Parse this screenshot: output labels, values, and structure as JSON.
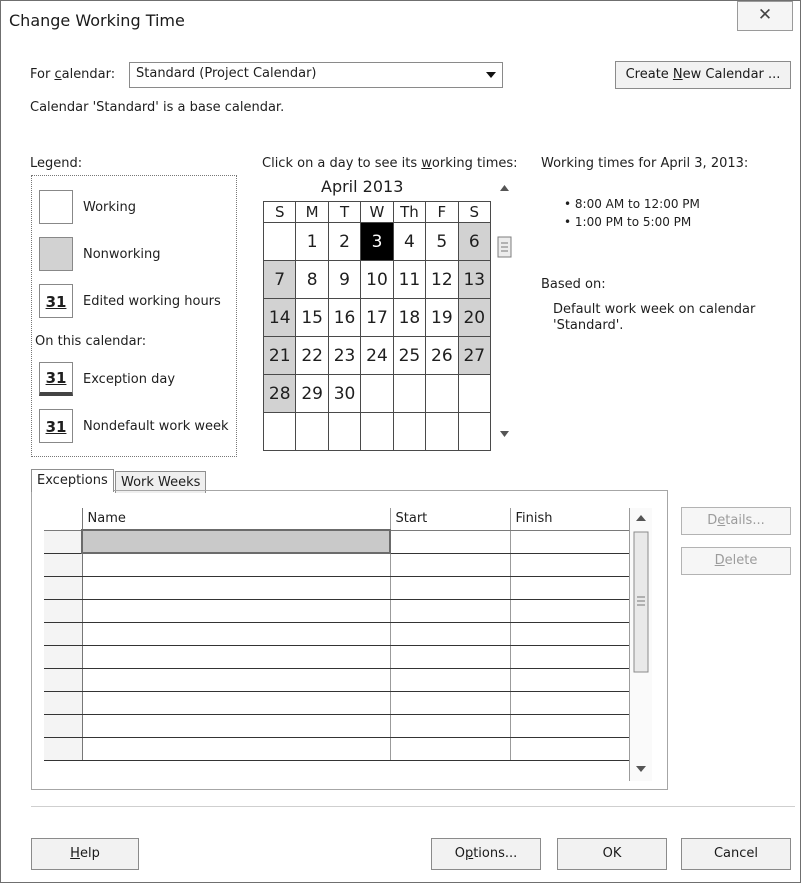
{
  "window": {
    "title": "Change Working Time"
  },
  "calendar_select": {
    "label_pre": "For ",
    "label_key": "c",
    "label_post": "alendar:",
    "value": "Standard (Project Calendar)"
  },
  "create_button": {
    "pre": "Create ",
    "key": "N",
    "post": "ew Calendar ..."
  },
  "base_note": "Calendar 'Standard' is a base calendar.",
  "legend": {
    "title": "Legend:",
    "working": "Working",
    "nonworking": "Nonworking",
    "edited": "Edited working hours",
    "on_this_calendar": "On this calendar:",
    "exception": "Exception day",
    "nondefault": "Nondefault work week",
    "icon_number": "31"
  },
  "calendar_prompt": {
    "pre": "Click on a day to see its ",
    "key": "w",
    "post": "orking times:"
  },
  "calendar": {
    "month": "April 2013",
    "weekdays": [
      "S",
      "M",
      "T",
      "W",
      "Th",
      "F",
      "S"
    ],
    "weeks": [
      [
        "",
        "1",
        "2",
        "3",
        "4",
        "5",
        "6"
      ],
      [
        "7",
        "8",
        "9",
        "10",
        "11",
        "12",
        "13"
      ],
      [
        "14",
        "15",
        "16",
        "17",
        "18",
        "19",
        "20"
      ],
      [
        "21",
        "22",
        "23",
        "24",
        "25",
        "26",
        "27"
      ],
      [
        "28",
        "29",
        "30",
        "",
        "",
        "",
        ""
      ],
      [
        "",
        "",
        "",
        "",
        "",
        "",
        ""
      ]
    ],
    "selected": "3"
  },
  "working_times": {
    "title": "Working times for April 3, 2013:",
    "items": [
      "• 8:00 AM to 12:00 PM",
      "• 1:00 PM to 5:00 PM"
    ],
    "based_on_label": "Based on:",
    "based_on_text_1": "Default work week on calendar",
    "based_on_text_2": "'Standard'."
  },
  "tabs": [
    {
      "label": "Exceptions",
      "active": true
    },
    {
      "label": "Work Weeks",
      "active": false
    }
  ],
  "exceptions_table": {
    "columns": [
      "Name",
      "Start",
      "Finish"
    ],
    "row_count": 10
  },
  "side_buttons": {
    "details": {
      "pre": "D",
      "key": "e",
      "post": "tails..."
    },
    "delete": {
      "pre": "",
      "key": "D",
      "post": "elete"
    }
  },
  "footer": {
    "help": {
      "pre": "",
      "key": "H",
      "post": "elp"
    },
    "options": {
      "pre": "O",
      "key": "p",
      "post": "tions..."
    },
    "ok": "OK",
    "cancel": "Cancel"
  },
  "colors": {
    "nonworking": "#d2d2d2",
    "selected_day": "#000000",
    "accent": "#1e1e1e"
  }
}
